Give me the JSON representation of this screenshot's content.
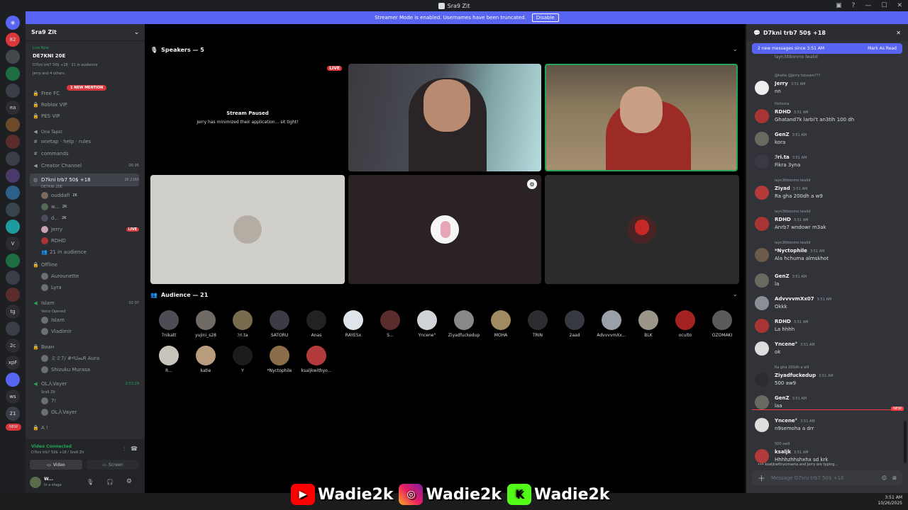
{
  "window": {
    "title": "Sra9 Zit"
  },
  "banner": {
    "text": "Streamer Mode is enabled. Usernames have been truncated.",
    "button": "Disable"
  },
  "server_rail": {
    "items": [
      "82",
      "ea",
      "2c",
      "xpF",
      "ws",
      "tg",
      "21",
      "NEW"
    ]
  },
  "sidebar": {
    "server_name": "Sra9 Zit",
    "live_label": "Live Now",
    "live_channel": "DE7KNI 20E",
    "live_sub": "D7kni trb7 50$ +18 · 21 in audience",
    "live_sub2": "Jerry and 4 others",
    "mention_badge": "1 NEW MENTION",
    "channels": [
      "Free FC",
      "Roblox VIP",
      "PES VIP",
      "One Tapst",
      "onetap · help · rules",
      "commands",
      "Creator Channel",
      "D7kni trb7 50$ +18",
      "DE7KNI 20E"
    ],
    "creator_counts": "00  05",
    "stage_counts": "26  2160",
    "voice_users": [
      "ouddafi",
      "w...",
      "d...",
      "Jerry",
      "RDHD",
      "21 in audience"
    ],
    "voice_badge": "2K",
    "live_badge": "LIVE",
    "offline_label": "Offline",
    "offline_users": [
      "Aurounette",
      "Lyra"
    ],
    "islam_channel": "Islam",
    "islam_counts": "02  07",
    "islam_sub": "Voice Opened",
    "islam_users": [
      "Islam",
      "Vladimir"
    ],
    "bwan_channel": "Виан",
    "bwan_users": [
      "ミミ7/ #ሃUጤR Aura",
      "Shizuku Murasa"
    ],
    "vayer_channel": "OL人Vayer",
    "vayer_time": "2:53:29",
    "vayer_sub": "Sra9 Zit",
    "vayer_users": [
      "7!",
      "OL人Vayer"
    ],
    "last_channel": "A !"
  },
  "voice_panel": {
    "status": "Video Connected",
    "channel": "D7kni trb7 50$ +18 / Sra9 Zit",
    "video_btn": "Video",
    "screen_btn": "Screen",
    "user": "W...",
    "user_sub": "In a stage"
  },
  "stage": {
    "speakers_label": "Speakers — 5",
    "paused_title": "Stream Paused",
    "paused_sub": "Jerry has minimized their application... sit tight!",
    "live_badge": "LIVE",
    "audience_label": "Audience — 21",
    "audience": [
      "7nikatt",
      "yujini_s28",
      "ℐri.ta",
      "SATORU",
      "Anas",
      "RAYESx",
      "S...",
      "Yncene°",
      "Ziyadfuckedup",
      "MOHA",
      "TRIN",
      "2aad",
      "AdvvvvmXx...",
      "BLK",
      "oculto",
      "OZOMAKI",
      "R...",
      "katie",
      "Y",
      "*Nyctophile",
      "ksaljkwithyo..."
    ]
  },
  "chat": {
    "title": "D7kni trb7 50$ +18",
    "new_messages": "2 new messages since 3:51 AM",
    "mark_read": "Mark As Read",
    "top_snippet": "layn3itbonmo lwalid",
    "messages": [
      {
        "name": "Jerry",
        "time": "3:51 AM",
        "text": "nn",
        "reply": "@katie @Jerry hossam???"
      },
      {
        "name": "RDHD",
        "time": "3:51 AM",
        "text": "Ghatand7k larbi't an3tih 100 dh",
        "reply": "Hshoma"
      },
      {
        "name": "GenZ",
        "time": "3:51 AM",
        "text": "kora",
        "reply": ""
      },
      {
        "name": "ℐri.ta",
        "time": "3:51 AM",
        "text": "Fikra 3yna",
        "reply": ""
      },
      {
        "name": "Ziyad",
        "time": "3:51 AM",
        "text": "Ra gha 200dh a w9",
        "reply": "layn3itbonmo lwalid"
      },
      {
        "name": "RDHD",
        "time": "3:51 AM",
        "text": "Anrb7 wndowr m3ak",
        "reply": "layn3itbonmo lwalid"
      },
      {
        "name": "*Nyctophile",
        "time": "3:51 AM",
        "text": "Ala hchuma almskhot",
        "reply": "layn3itbonmo lwalid"
      },
      {
        "name": "GenZ",
        "time": "3:51 AM",
        "text": "la",
        "reply": ""
      },
      {
        "name": "AdvvvvmXx07",
        "time": "3:51 AM",
        "text": "Okkk",
        "reply": ""
      },
      {
        "name": "RDHD",
        "time": "3:51 AM",
        "text": "La hhhh",
        "reply": ""
      },
      {
        "name": "Yncene°",
        "time": "3:51 AM",
        "text": "ok",
        "reply": ""
      },
      {
        "name": "Ziyadfuckedup",
        "time": "3:51 AM",
        "text": "500 aw9",
        "reply": "Ra gha 200dh a w9"
      },
      {
        "name": "GenZ",
        "time": "3:51 AM",
        "text": "laa",
        "reply": ""
      },
      {
        "name": "Yncene°",
        "time": "3:51 AM",
        "text": "n9semoha a drr",
        "reply": ""
      },
      {
        "name": "ksaljk",
        "time": "3:51 AM",
        "text": "Hhhhzhhshxhx sd krk",
        "reply": "500 aw9"
      }
    ],
    "new_tag": "NEW",
    "typing": "ksaljkwithyomama and Jerry are typing...",
    "input_placeholder": "Message D7kni trb7 50$ +18"
  },
  "overlay": {
    "youtube": "Wadie2k",
    "instagram": "Wadie2k",
    "kick": "Wadie2k"
  },
  "taskbar": {
    "time": "3:51 AM",
    "date": "10/26/2025"
  },
  "colors": {
    "blurple": "#5865f2",
    "live_red": "#da373c",
    "online_green": "#23a55a",
    "kick_green": "#53fc18",
    "youtube_red": "#ff0000"
  }
}
